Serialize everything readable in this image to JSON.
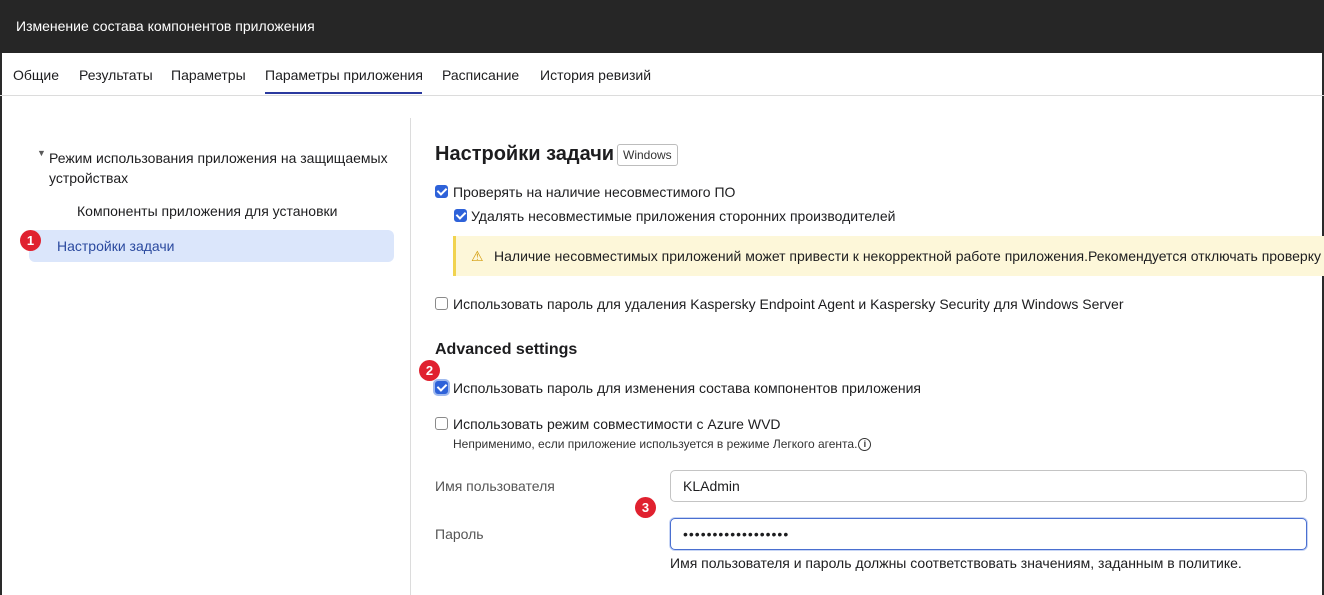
{
  "window": {
    "title": "Изменение состава компонентов приложения"
  },
  "tabs": [
    {
      "label": "Общие"
    },
    {
      "label": "Результаты"
    },
    {
      "label": "Параметры"
    },
    {
      "label": "Параметры приложения",
      "active": true
    },
    {
      "label": "Расписание"
    },
    {
      "label": "История ревизий"
    }
  ],
  "sidebar": {
    "root_label": "Режим использования приложения на защищаемых устройствах",
    "child_label": "Компоненты приложения для установки",
    "active_label": "Настройки задачи"
  },
  "callouts": {
    "one": "1",
    "two": "2",
    "three": "3"
  },
  "main": {
    "title": "Настройки задачи",
    "os_badge": "Windows",
    "check_incompatible": {
      "label": "Проверять на наличие несовместимого ПО",
      "checked": true
    },
    "remove_incompatible": {
      "label": "Удалять несовместимые приложения сторонних производителей",
      "checked": true
    },
    "warning": "Наличие несовместимых приложений может привести к некорректной работе приложения.Рекомендуется отключать проверку т",
    "password_uninstall": {
      "label": "Использовать пароль для удаления Kaspersky Endpoint Agent и Kaspersky Security для Windows Server",
      "checked": false
    },
    "advanced_title": "Advanced settings",
    "password_modify": {
      "label": "Использовать пароль для изменения состава компонентов приложения",
      "checked": true
    },
    "azure_wvd": {
      "label": "Использовать режим совместимости с Azure WVD",
      "checked": false
    },
    "azure_note": "Неприменимо, если приложение используется в режиме Легкого агента.",
    "username_label": "Имя пользователя",
    "username_value": "KLAdmin",
    "password_label": "Пароль",
    "password_value": "••••••••••••••••••",
    "hint": "Имя пользователя и пароль должны соответствовать значениям, заданным в политике."
  },
  "colors": {
    "accent": "#2e62d9",
    "callout": "#e0212f",
    "titlebar": "#262626",
    "active_item_bg": "#dbe6fb",
    "warning_bg": "#fdf7d9"
  },
  "icons": {
    "warning": "warning-icon",
    "info": "info-icon",
    "caret": "caret-down-icon"
  }
}
